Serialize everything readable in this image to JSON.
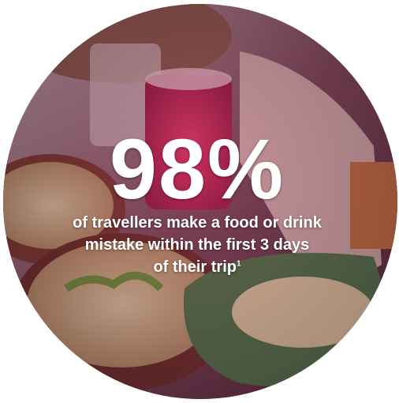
{
  "stat": {
    "value": "98%",
    "caption_line1": "of travellers make a food or drink",
    "caption_line2": "mistake within the first 3 days",
    "caption_line3": "of their trip",
    "footnote_marker": "1"
  },
  "colors": {
    "text": "#ffffff",
    "tint": "#8a2a52"
  }
}
